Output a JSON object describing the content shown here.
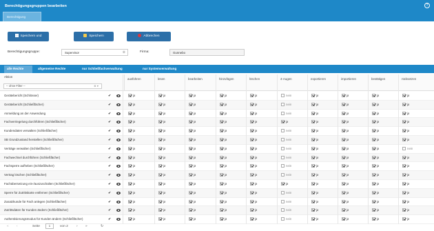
{
  "window": {
    "title": "Berechtigungsgruppen bearbeiten",
    "subtab": "Berechtigung",
    "help_icon": "help-icon"
  },
  "toolbar": {
    "save_close": "Speichern und schließen",
    "save": "Speichern",
    "cancel": "Abbrechen"
  },
  "form": {
    "group_label": "Berechtigungsgruppe:",
    "group_value": "Supervisor",
    "company_label": "Firma:",
    "company_value": "Gunnebo"
  },
  "tabs": [
    "alle Rechte",
    "allgemeine Rechte",
    "nur Schließfachverwaltung",
    "nur Systemverwaltung"
  ],
  "grid": {
    "action_header": "Aktion",
    "filter_placeholder": "-- ohne Filter --",
    "columns": [
      "ausführen",
      "lesen",
      "bearbeiten",
      "hinzufügen",
      "löschen",
      "4-Augen",
      "exportieren",
      "importieren",
      "bestätigen",
      "rücksetzen"
    ],
    "yes": "ja",
    "no": "nein",
    "rows": [
      {
        "label": "Gerätebericht (Schlösser)",
        "vals": [
          1,
          1,
          1,
          1,
          1,
          0,
          1,
          1,
          1,
          1
        ]
      },
      {
        "label": "Gerätebericht (Schließfächer)",
        "vals": [
          1,
          1,
          1,
          1,
          1,
          0,
          1,
          1,
          1,
          1
        ]
      },
      {
        "label": "Anmeldung an der Anwendung",
        "vals": [
          1,
          1,
          1,
          1,
          1,
          0,
          1,
          1,
          1,
          1
        ]
      },
      {
        "label": "Fachverriegelung durchführen (Schließfächer)",
        "vals": [
          1,
          1,
          1,
          1,
          1,
          1,
          1,
          1,
          1,
          1
        ]
      },
      {
        "label": "Kundendaten verwalten (Schließfächer)",
        "vals": [
          1,
          1,
          1,
          1,
          1,
          0,
          1,
          1,
          1,
          1
        ]
      },
      {
        "label": "SB Grundzustand herstellen (Schließfächer)",
        "vals": [
          1,
          1,
          1,
          1,
          1,
          0,
          1,
          1,
          1,
          1
        ]
      },
      {
        "label": "Verträge verwalten (Schließfächer)",
        "vals": [
          1,
          1,
          1,
          1,
          1,
          0,
          1,
          1,
          1,
          0
        ]
      },
      {
        "label": "Fachwechsel durchführen (Schließfächer)",
        "vals": [
          1,
          1,
          1,
          1,
          1,
          0,
          1,
          1,
          1,
          1
        ]
      },
      {
        "label": "Fachsperre aufheben (Schließfächer)",
        "vals": [
          1,
          1,
          1,
          1,
          1,
          0,
          1,
          1,
          1,
          1
        ]
      },
      {
        "label": "Vertrag löschen (Schließfächer)",
        "vals": [
          1,
          1,
          1,
          1,
          1,
          0,
          1,
          1,
          1,
          1
        ]
      },
      {
        "label": "Fachübersetzung ein-/auszuschalten (Schließfächer)",
        "vals": [
          1,
          1,
          1,
          1,
          1,
          1,
          1,
          1,
          1,
          1
        ]
      },
      {
        "label": "Sperre für Zutrittskarte entfernen (Schließfächer)",
        "vals": [
          1,
          1,
          1,
          1,
          1,
          0,
          1,
          1,
          1,
          1
        ]
      },
      {
        "label": "Zusatzkunde für Fach anlegen (Schließfächer)",
        "vals": [
          1,
          1,
          1,
          1,
          1,
          0,
          1,
          1,
          1,
          1
        ]
      },
      {
        "label": "Zutrittsdaten für Kunden ändern (Schließfächer)",
        "vals": [
          1,
          1,
          1,
          1,
          1,
          0,
          1,
          1,
          1,
          1
        ]
      },
      {
        "label": "Authentisierungsmodus für Kunden ändern (Schließfächer)",
        "vals": [
          1,
          1,
          1,
          1,
          1,
          0,
          1,
          1,
          1,
          1
        ]
      }
    ]
  },
  "pager": {
    "page_label": "Seite",
    "page_value": "1",
    "of_label": "von 2"
  }
}
